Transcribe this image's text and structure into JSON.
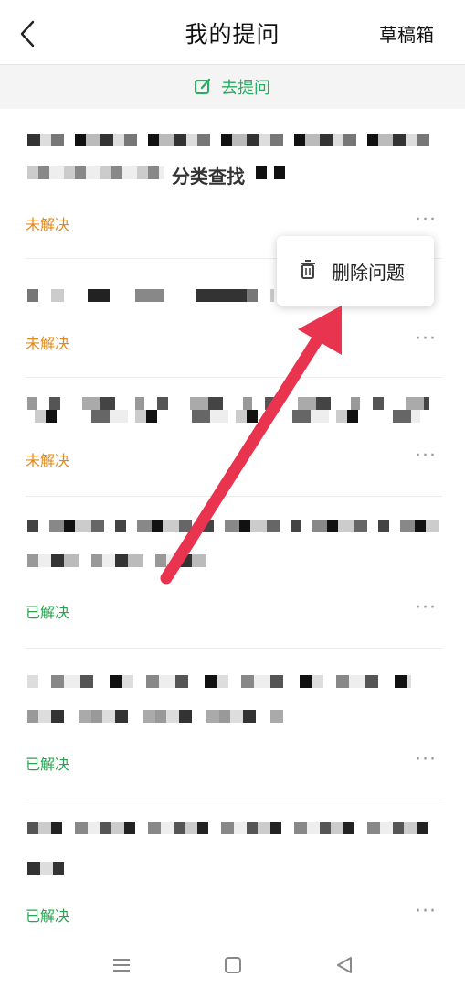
{
  "header": {
    "title": "我的提问",
    "drafts_label": "草稿箱"
  },
  "ask_bar": {
    "label": "去提问"
  },
  "popup": {
    "delete_label": "删除问题"
  },
  "questions": [
    {
      "status": "未解决",
      "status_type": "unresolved",
      "visible_fragment": "分类查找",
      "more": "···"
    },
    {
      "status": "未解决",
      "status_type": "unresolved",
      "visible_fragment": "",
      "more": "···"
    },
    {
      "status": "未解决",
      "status_type": "unresolved",
      "visible_fragment": "",
      "more": "···"
    },
    {
      "status": "已解决",
      "status_type": "resolved",
      "visible_fragment": "",
      "more": "···"
    },
    {
      "status": "已解决",
      "status_type": "resolved",
      "visible_fragment": "",
      "more": "···"
    },
    {
      "status": "已解决",
      "status_type": "resolved",
      "visible_fragment": "",
      "more": "···"
    }
  ],
  "colors": {
    "resolved": "#2aa350",
    "unresolved": "#e08a1e",
    "accent": "#27ae60",
    "annotation_arrow": "#e8344e"
  },
  "icons": [
    "back-arrow-icon",
    "edit-icon",
    "trash-icon",
    "more-icon",
    "menu-icon",
    "home-square-icon",
    "back-triangle-icon"
  ]
}
